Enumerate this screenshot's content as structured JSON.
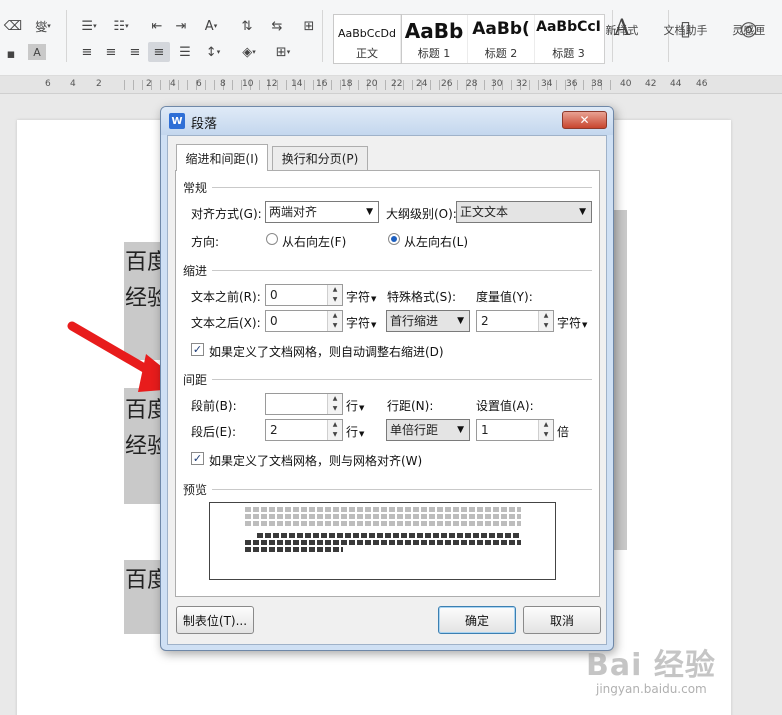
{
  "ribbon": {
    "icons": [
      "eraser-icon",
      "phonetic-guide-icon",
      "bullets-icon",
      "numbering-icon",
      "decrease-indent-icon",
      "increase-indent-icon",
      "text-direction-icon",
      "tab-icon",
      "table-icon"
    ],
    "phonetic_label": "燮",
    "char_shading_label": "A",
    "styles": [
      {
        "sample": "AaBbCcDd",
        "name": "正文"
      },
      {
        "sample": "AaBb",
        "name": "标题 1"
      },
      {
        "sample": "AaBb(",
        "name": "标题 2"
      },
      {
        "sample": "AaBbCcI",
        "name": "标题 3"
      }
    ],
    "new_style_label": "新样式",
    "doc_assistant_label": "文档助手",
    "inspiration_label": "灵感匣"
  },
  "ruler": {
    "numbers": [
      "6",
      "4",
      "2",
      "2",
      "4",
      "6",
      "8",
      "10",
      "12",
      "14",
      "16",
      "18",
      "20",
      "22",
      "24",
      "26",
      "28",
      "30",
      "32",
      "34",
      "36",
      "38",
      "40",
      "42",
      "44",
      "46"
    ]
  },
  "document": {
    "fragments": [
      "百度",
      "经验",
      "百度",
      "经验",
      "百度"
    ]
  },
  "dialog": {
    "title": "段落",
    "close_label": "✕",
    "tabs": [
      "缩进和间距(I)",
      "换行和分页(P)"
    ],
    "general": {
      "section_title": "常规",
      "alignment_label": "对齐方式(G):",
      "alignment_value": "两端对齐",
      "outline_label": "大纲级别(O):",
      "outline_value": "正文文本",
      "direction_label": "方向:",
      "rtl_label": "从右向左(F)",
      "ltr_label": "从左向右(L)"
    },
    "indent": {
      "section_title": "缩进",
      "before_label": "文本之前(R):",
      "before_value": "0",
      "after_label": "文本之后(X):",
      "after_value": "0",
      "unit": "字符",
      "special_label": "特殊格式(S):",
      "special_value": "首行缩进",
      "measure_label": "度量值(Y):",
      "measure_value": "2",
      "measure_unit": "字符",
      "auto_adjust_label": "如果定义了文档网格，则自动调整右缩进(D)"
    },
    "spacing": {
      "section_title": "间距",
      "before_label": "段前(B):",
      "before_value": "",
      "after_label": "段后(E):",
      "after_value": "2",
      "unit": "行",
      "line_spacing_label": "行距(N):",
      "line_spacing_value": "单倍行距",
      "setting_label": "设置值(A):",
      "setting_value": "1",
      "setting_unit": "倍",
      "snap_grid_label": "如果定义了文档网格，则与网格对齐(W)"
    },
    "preview": {
      "section_title": "预览"
    },
    "buttons": {
      "tabs_label": "制表位(T)...",
      "ok_label": "确定",
      "cancel_label": "取消"
    }
  },
  "watermark": {
    "logo": "Bai 经验",
    "url": "jingyan.baidu.com"
  },
  "colors": {
    "accent": "#1d5fbf",
    "arrow": "#e81c1c",
    "close": "#c8452e"
  }
}
